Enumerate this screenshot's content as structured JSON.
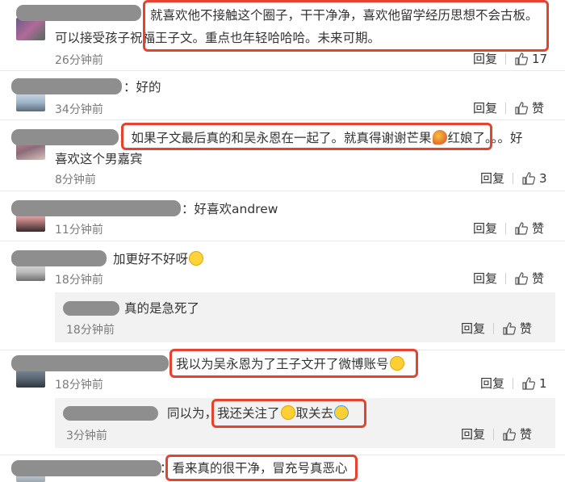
{
  "actions": {
    "reply_label": "回复",
    "like_word": "赞"
  },
  "comments": [
    {
      "text1": "就喜欢他不接触这个圈子，干干净净，喜欢他留学经历思想不会古板。",
      "text2": "可以接受孩子祝福王子文。重点也年轻哈哈哈。未来可期。",
      "time": "26分钟前",
      "likes": "17"
    },
    {
      "text1": "：好的",
      "time": "34分钟前",
      "likes": "赞"
    },
    {
      "text1_pre": "：",
      "text1_hl": "如果子文最后真的和吴永恩在一起了。就真得谢谢芒果",
      "text1_hl2": "红娘了。",
      "text1_post": "。。好",
      "text2": "喜欢这个男嘉宾",
      "time": "8分钟前",
      "likes": "3"
    },
    {
      "text1": "：好喜欢andrew",
      "time": "11分钟前",
      "likes": "赞"
    },
    {
      "text1": "加更好不好呀",
      "time": "18分钟前",
      "likes": "赞"
    },
    {
      "text1": "真的是急死了",
      "time": "18分钟前",
      "likes": "赞"
    },
    {
      "text1": "我以为吴永恩为了王子文开了微博账号",
      "time": "18分钟前",
      "likes": "1"
    },
    {
      "text1_pre": "同以为，",
      "text1_hl": "我还关注了",
      "text1_mid": "取关去",
      "time": "3分钟前",
      "likes": "赞"
    },
    {
      "text1": "：看来真的很干净，冒充号真恶心"
    }
  ],
  "emoji_names": [
    "mango-emoji",
    "scared-face-emoji",
    "rolling-laugh-emoji",
    "tears-of-joy-emoji",
    "crying-face-emoji"
  ]
}
